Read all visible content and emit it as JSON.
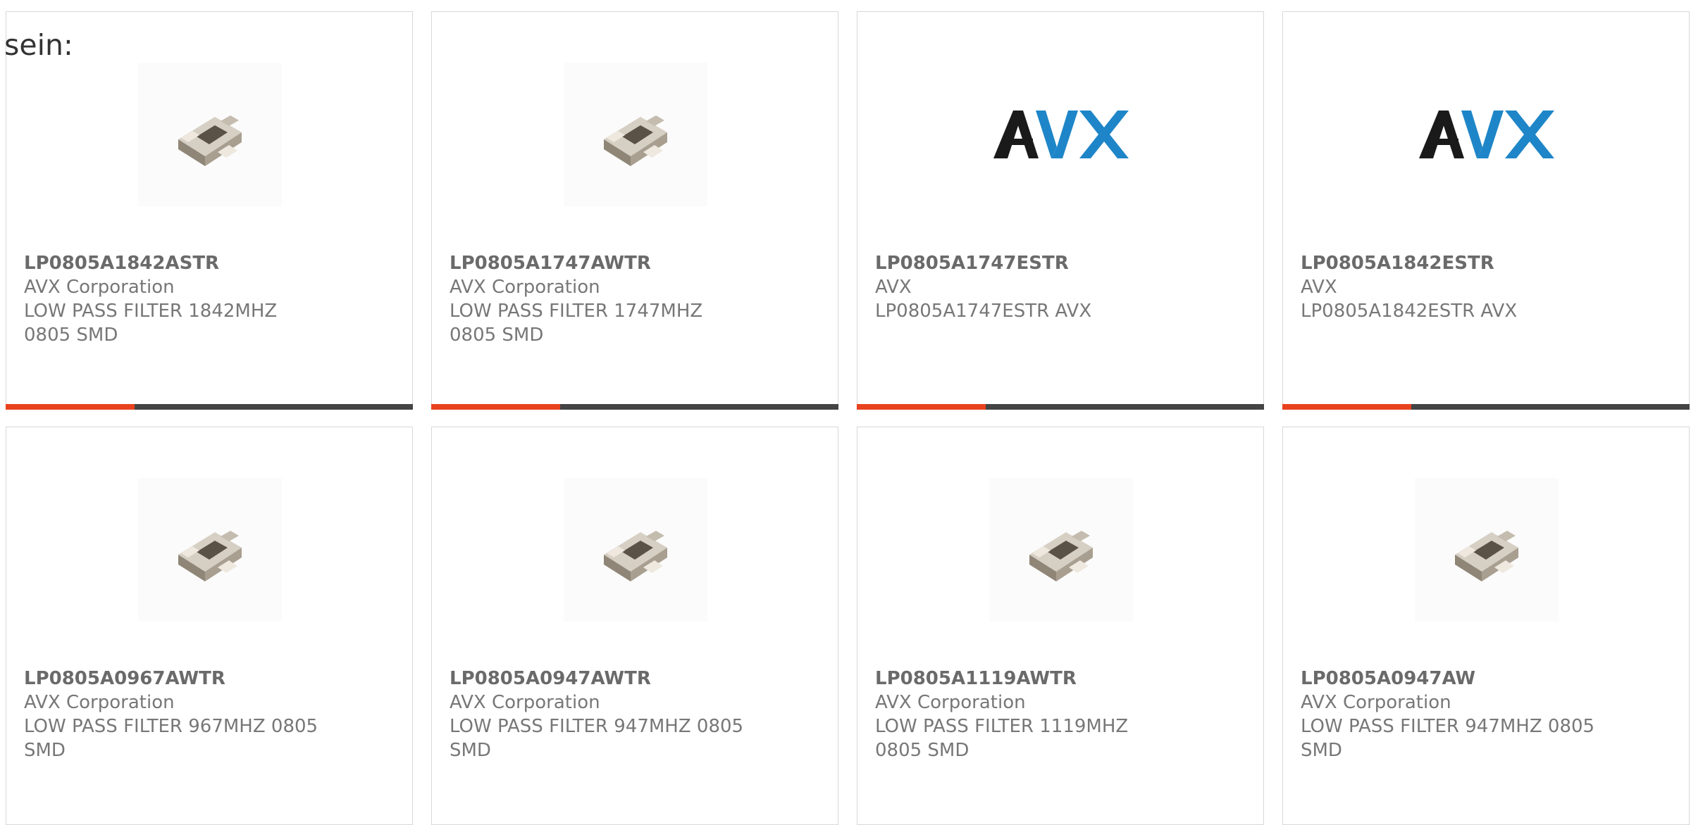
{
  "lead_text": "sein:",
  "colors": {
    "accent": "#e8421f",
    "bar": "#444444",
    "border": "#d8d8d8",
    "avx_dark": "#1a1a1a",
    "avx_blue": "#1e86c8"
  },
  "products": [
    {
      "part_number": "LP0805A1842ASTR",
      "manufacturer": "AVX Corporation",
      "description": "LOW PASS FILTER 1842MHZ 0805 SMD",
      "image": "chip-component-icon"
    },
    {
      "part_number": "LP0805A1747AWTR",
      "manufacturer": "AVX Corporation",
      "description": "LOW PASS FILTER 1747MHZ 0805 SMD",
      "image": "chip-component-icon"
    },
    {
      "part_number": "LP0805A1747ESTR",
      "manufacturer": "AVX",
      "description": "LP0805A1747ESTR AVX",
      "image": "avx-logo",
      "logo_text": "AVX"
    },
    {
      "part_number": "LP0805A1842ESTR",
      "manufacturer": "AVX",
      "description": "LP0805A1842ESTR AVX",
      "image": "avx-logo",
      "logo_text": "AVX"
    },
    {
      "part_number": "LP0805A0967AWTR",
      "manufacturer": "AVX Corporation",
      "description": "LOW PASS FILTER 967MHZ 0805 SMD",
      "image": "chip-component-icon"
    },
    {
      "part_number": "LP0805A0947AWTR",
      "manufacturer": "AVX Corporation",
      "description": "LOW PASS FILTER 947MHZ 0805 SMD",
      "image": "chip-component-icon"
    },
    {
      "part_number": "LP0805A1119AWTR",
      "manufacturer": "AVX Corporation",
      "description": "LOW PASS FILTER 1119MHZ 0805 SMD",
      "image": "chip-component-icon"
    },
    {
      "part_number": "LP0805A0947AW",
      "manufacturer": "AVX Corporation",
      "description": "LOW PASS FILTER 947MHZ 0805 SMD",
      "image": "chip-component-icon"
    }
  ]
}
